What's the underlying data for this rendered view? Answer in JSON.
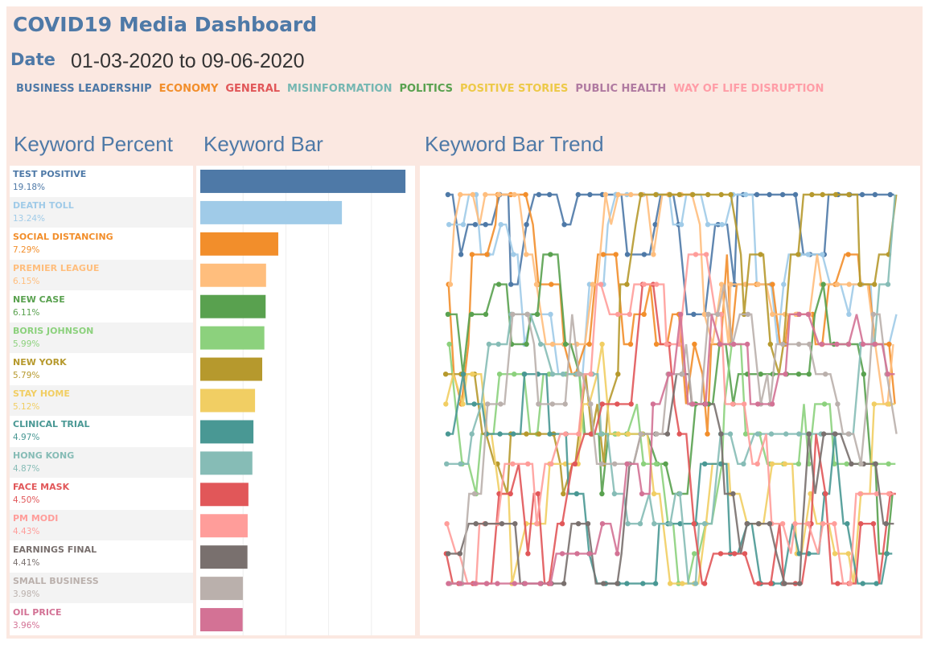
{
  "header": {
    "title": "COVID19 Media Dashboard",
    "date_label": "Date",
    "date_range": "01-03-2020 to 09-06-2020"
  },
  "legend": [
    {
      "label": "BUSINESS LEADERSHIP",
      "color": "#4e79a7"
    },
    {
      "label": "ECONOMY",
      "color": "#f28e2b"
    },
    {
      "label": "GENERAL",
      "color": "#e15759"
    },
    {
      "label": "MISINFORMATION",
      "color": "#76b7b2"
    },
    {
      "label": "POLITICS",
      "color": "#59a14f"
    },
    {
      "label": "POSITIVE STORIES",
      "color": "#edc948"
    },
    {
      "label": "PUBLIC HEALTH",
      "color": "#b07aa1"
    },
    {
      "label": "WAY OF LIFE DISRUPTION",
      "color": "#ff9da7"
    }
  ],
  "sections": {
    "keyword_percent": "Keyword Percent",
    "keyword_bar": "Keyword Bar",
    "keyword_bar_trend": "Keyword Bar Trend"
  },
  "chart_data": [
    {
      "type": "table",
      "title": "Keyword Percent",
      "rows": [
        {
          "keyword": "TEST POSITIVE",
          "percent": "19.18%",
          "color": "#4e79a7"
        },
        {
          "keyword": "DEATH TOLL",
          "percent": "13.24%",
          "color": "#a0cbe8"
        },
        {
          "keyword": "SOCIAL DISTANCING",
          "percent": "7.29%",
          "color": "#f28e2b"
        },
        {
          "keyword": "PREMIER LEAGUE",
          "percent": "6.15%",
          "color": "#ffbe7d"
        },
        {
          "keyword": "NEW CASE",
          "percent": "6.11%",
          "color": "#59a14f"
        },
        {
          "keyword": "BORIS JOHNSON",
          "percent": "5.99%",
          "color": "#8cd17d"
        },
        {
          "keyword": "NEW YORK",
          "percent": "5.79%",
          "color": "#b6992d"
        },
        {
          "keyword": "STAY HOME",
          "percent": "5.12%",
          "color": "#f1ce63"
        },
        {
          "keyword": "CLINICAL TRIAL",
          "percent": "4.97%",
          "color": "#499894"
        },
        {
          "keyword": "HONG KONG",
          "percent": "4.87%",
          "color": "#86bcb6"
        },
        {
          "keyword": "FACE MASK",
          "percent": "4.50%",
          "color": "#e15759"
        },
        {
          "keyword": "PM MODI",
          "percent": "4.43%",
          "color": "#ff9d9a"
        },
        {
          "keyword": "EARNINGS FINAL",
          "percent": "4.41%",
          "color": "#79706e"
        },
        {
          "keyword": "SMALL BUSINESS",
          "percent": "3.98%",
          "color": "#bab0ac"
        },
        {
          "keyword": "OIL PRICE",
          "percent": "3.96%",
          "color": "#d37295"
        }
      ]
    },
    {
      "type": "bar",
      "title": "Keyword Bar",
      "categories": [
        "TEST POSITIVE",
        "DEATH TOLL",
        "SOCIAL DISTANCING",
        "PREMIER LEAGUE",
        "NEW CASE",
        "BORIS JOHNSON",
        "NEW YORK",
        "STAY HOME",
        "CLINICAL TRIAL",
        "HONG KONG",
        "FACE MASK",
        "PM MODI",
        "EARNINGS FINAL",
        "SMALL BUSINESS",
        "OIL PRICE"
      ],
      "values": [
        19.18,
        13.24,
        7.29,
        6.15,
        6.11,
        5.99,
        5.79,
        5.12,
        4.97,
        4.87,
        4.5,
        4.43,
        4.41,
        3.98,
        3.96
      ],
      "colors": [
        "#4e79a7",
        "#a0cbe8",
        "#f28e2b",
        "#ffbe7d",
        "#59a14f",
        "#8cd17d",
        "#b6992d",
        "#f1ce63",
        "#499894",
        "#86bcb6",
        "#e15759",
        "#ff9d9a",
        "#79706e",
        "#bab0ac",
        "#d37295"
      ],
      "orientation": "horizontal",
      "xlim": [
        0,
        20
      ],
      "grid": true
    },
    {
      "type": "line",
      "title": "Keyword Bar Trend",
      "ranks": 15,
      "rank_levels_used": 14,
      "grid": false,
      "series_colors": [
        "#4e79a7",
        "#a0cbe8",
        "#f28e2b",
        "#ffbe7d",
        "#59a14f",
        "#8cd17d",
        "#b6992d",
        "#f1ce63",
        "#499894",
        "#86bcb6",
        "#e15759",
        "#ff9d9a",
        "#79706e",
        "#bab0ac",
        "#d37295"
      ]
    }
  ]
}
